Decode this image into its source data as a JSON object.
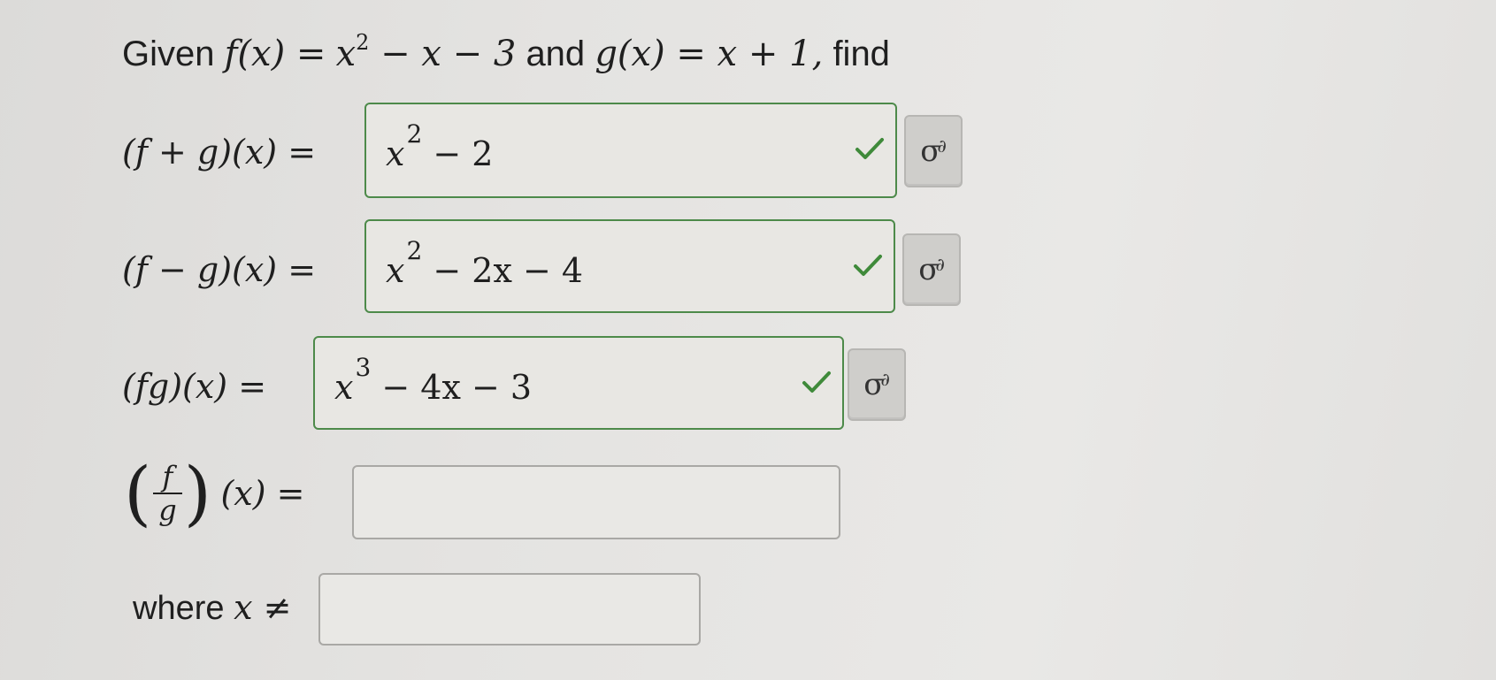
{
  "problem": {
    "given_word": "Given",
    "f_lhs": "f(x) =",
    "f_rhs_a": "x",
    "f_rhs_exp": "2",
    "f_rhs_b": " − x − 3",
    "and_word": "and",
    "g_def": "g(x) = x + 1,",
    "find_word": "find"
  },
  "rows": [
    {
      "label": "(f + g)(x) =",
      "answer_base": "x",
      "answer_exp": "2",
      "answer_rest": " − 2",
      "status": "correct",
      "keypad_icon": "sigma-keypad-icon"
    },
    {
      "label": "(f − g)(x) =",
      "answer_base": "x",
      "answer_exp": "2",
      "answer_rest": " − 2x − 4",
      "status": "correct",
      "keypad_icon": "sigma-keypad-icon"
    },
    {
      "label": "(fg)(x) =",
      "answer_base": "x",
      "answer_exp": "3",
      "answer_rest": " − 4x − 3",
      "status": "correct",
      "keypad_icon": "sigma-keypad-icon"
    }
  ],
  "quotient_row": {
    "numerator": "f",
    "denominator": "g",
    "tail": "(x) =",
    "value": ""
  },
  "restriction_row": {
    "word": "where",
    "expr": "x ≠",
    "value": ""
  },
  "colors": {
    "correct_border": "#4d8a4a",
    "check": "#3f8a3a",
    "empty_border": "#a9a8a5",
    "keypad_bg": "#cfcecb"
  }
}
